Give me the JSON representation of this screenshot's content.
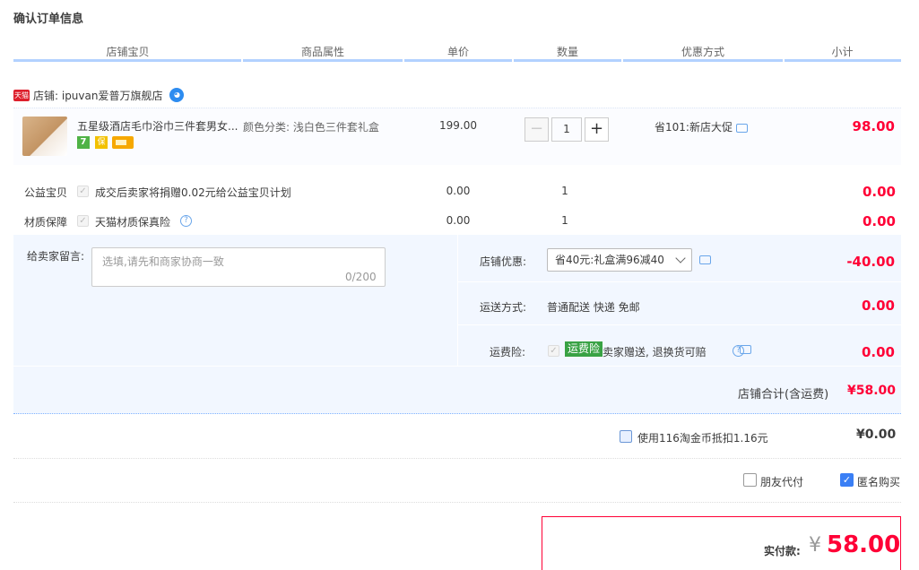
{
  "page_title": "确认订单信息",
  "columns": [
    "店铺宝贝",
    "商品属性",
    "单价",
    "数量",
    "优惠方式",
    "小计"
  ],
  "store": {
    "badge": "天猫",
    "label": "店铺: ipuvan爱普万旗舰店",
    "chat_icon_text": "◕"
  },
  "item": {
    "title": "五星级酒店毛巾浴巾三件套男女...",
    "services": [
      "7",
      "保"
    ],
    "attribute": "颜色分类: 浅白色三件套礼盒",
    "unit_price": "199.00",
    "quantity": "1",
    "qty_minus": "−",
    "qty_plus": "+",
    "promo": "省101:新店大促",
    "subtotal": "98.00"
  },
  "extra_services": [
    {
      "label": "公益宝贝",
      "text": "成交后卖家将捐赠0.02元给公益宝贝计划",
      "price": "0.00",
      "qty": "1",
      "subtotal": "0.00"
    },
    {
      "label": "材质保障",
      "text": "天猫材质保真险",
      "price": "0.00",
      "qty": "1",
      "subtotal": "0.00"
    }
  ],
  "message": {
    "label": "给卖家留言:",
    "placeholder": "选填,请先和商家协商一致",
    "counter": "0/200"
  },
  "store_discount": {
    "label": "店铺优惠:",
    "selected": "省40元:礼盒满96减40",
    "amount": "-40.00"
  },
  "shipping": {
    "label": "运送方式:",
    "text": "普通配送 快递 免邮",
    "amount": "0.00"
  },
  "freight_insurance": {
    "label": "运费险:",
    "tag": "运费险",
    "text": "卖家赠送, 退换货可赔",
    "amount": "0.00"
  },
  "store_total": {
    "label": "店铺合计(含运费)",
    "amount": "¥58.00"
  },
  "taobao_coin": {
    "text": "使用116淘金币抵扣1.16元",
    "amount": "¥0.00"
  },
  "options": {
    "friend_pay": "朋友代付",
    "anonymous": "匿名购买",
    "check_mark": "✓"
  },
  "payment": {
    "label": "实付款:",
    "currency": "¥",
    "amount": "58.00"
  },
  "colors": {
    "accent_red": "#ff0036",
    "header_line": "#b2d1ff",
    "panel_bg": "#f2f7ff"
  }
}
